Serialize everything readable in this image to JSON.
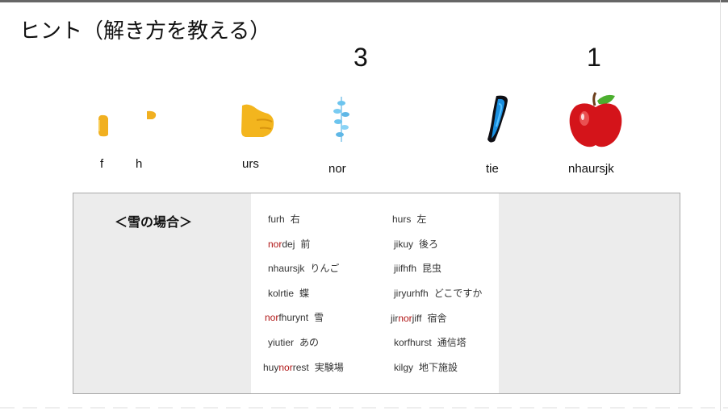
{
  "title": "ヒント（解き方を教える）",
  "counts": [
    "3",
    "1"
  ],
  "pictures": [
    {
      "icon": "fragment-icon",
      "label": "f"
    },
    {
      "icon": "fragment-icon",
      "label": "h"
    },
    {
      "icon": "hand-icon",
      "label": "urs"
    },
    {
      "icon": "snowflake-icon",
      "label": "nor"
    },
    {
      "icon": "butterfly-icon",
      "label": "tie"
    },
    {
      "icon": "apple-icon",
      "label": "nhaursjk"
    }
  ],
  "panel": {
    "title": "＜雪の場合＞",
    "highlight_color": "#b01515",
    "left_column": [
      {
        "pre": "furh",
        "hl": "",
        "post": "",
        "gloss": "右"
      },
      {
        "pre": "",
        "hl": "nor",
        "post": "dej",
        "gloss": "前"
      },
      {
        "pre": "nhaursjk",
        "hl": "",
        "post": "",
        "gloss": "りんご"
      },
      {
        "pre": "kolrtie",
        "hl": "",
        "post": "",
        "gloss": "蝶"
      },
      {
        "pre": "",
        "hl": "nor",
        "post": "fhurynt",
        "gloss": "雪"
      },
      {
        "pre": "yiutier",
        "hl": "",
        "post": "",
        "gloss": "あの"
      },
      {
        "pre": "huy",
        "hl": "nor",
        "post": "rest",
        "gloss": "実験場"
      }
    ],
    "right_column": [
      {
        "pre": "hurs",
        "hl": "",
        "post": "",
        "gloss": "左"
      },
      {
        "pre": "jikuy",
        "hl": "",
        "post": "",
        "gloss": "後ろ"
      },
      {
        "pre": "jiifhfh",
        "hl": "",
        "post": "",
        "gloss": "昆虫"
      },
      {
        "pre": "jiryurhfh",
        "hl": "",
        "post": "",
        "gloss": "どこですか"
      },
      {
        "pre": "jir",
        "hl": "nor",
        "post": "jiff",
        "gloss": "宿舎"
      },
      {
        "pre": "korfhurst",
        "hl": "",
        "post": "",
        "gloss": "通信塔"
      },
      {
        "pre": "kilgy",
        "hl": "",
        "post": "",
        "gloss": "地下施設"
      }
    ]
  }
}
